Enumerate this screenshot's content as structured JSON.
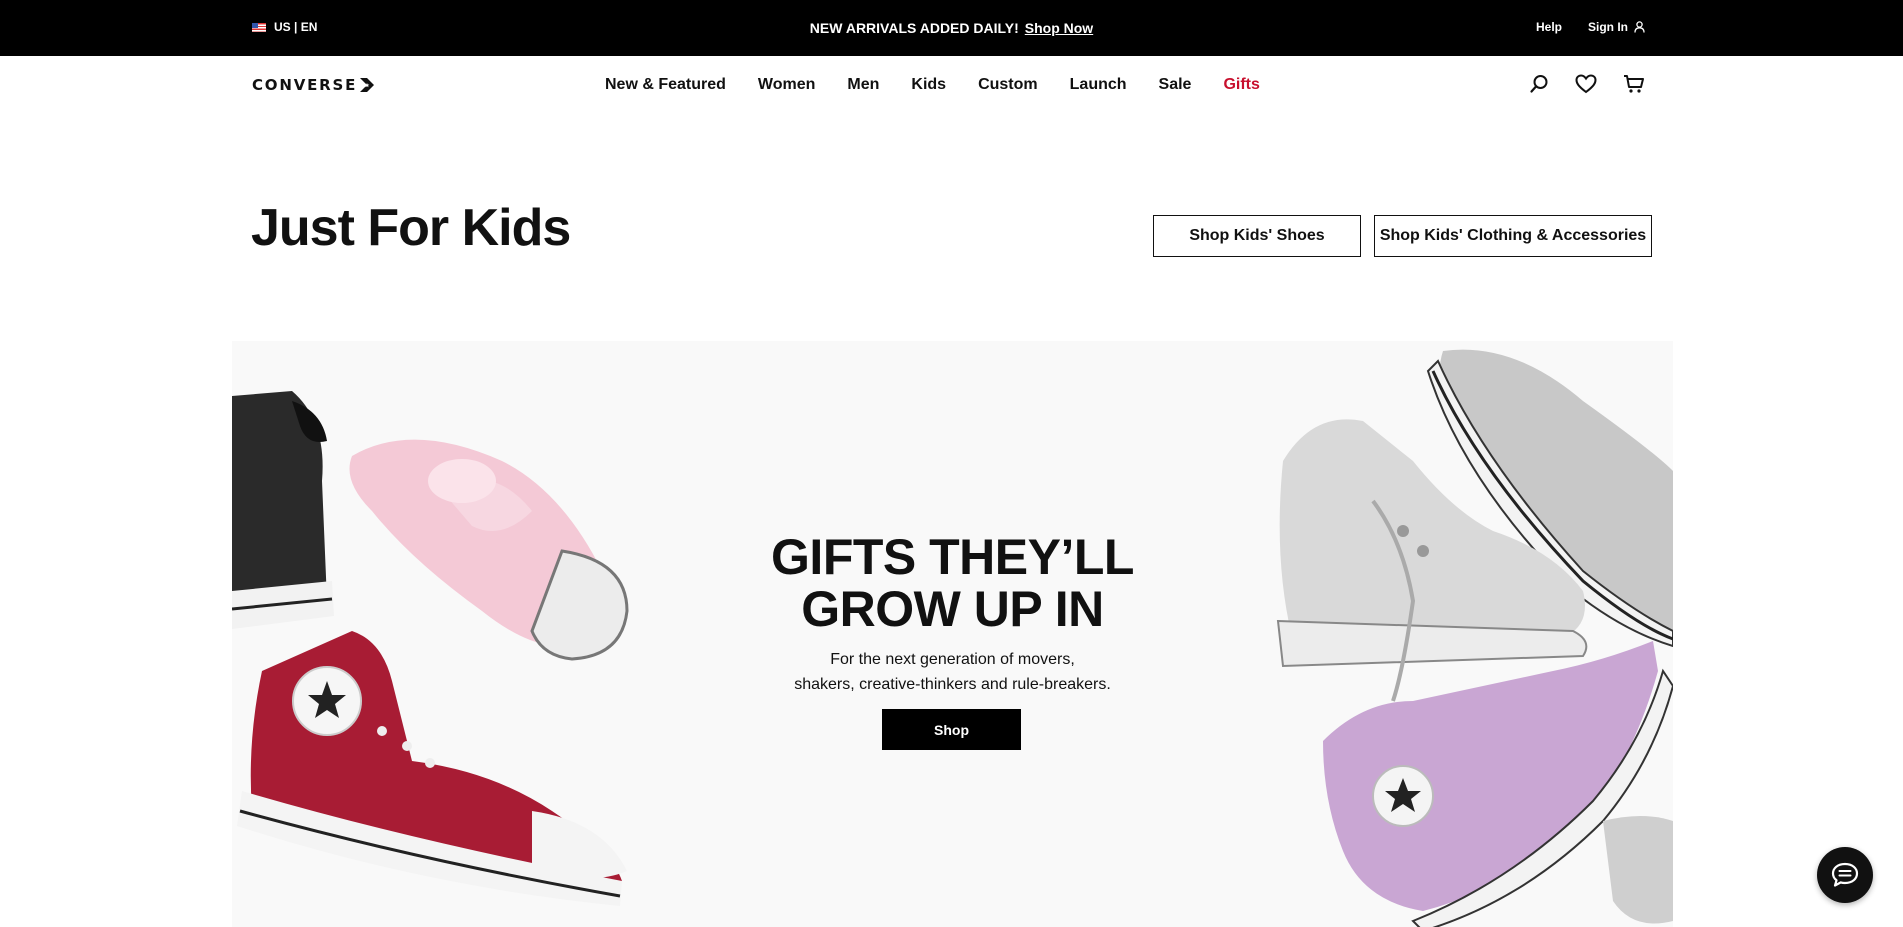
{
  "topbar": {
    "locale": "US | EN",
    "promo_text": "NEW ARRIVALS ADDED DAILY!",
    "promo_link": "Shop Now",
    "help": "Help",
    "sign_in": "Sign In"
  },
  "brand": {
    "logo_text": "CONVERSE"
  },
  "nav": {
    "items": [
      "New & Featured",
      "Women",
      "Men",
      "Kids",
      "Custom",
      "Launch",
      "Sale",
      "Gifts"
    ],
    "highlight_color": "#c8102e"
  },
  "icons": [
    "flag-us-icon",
    "user-icon",
    "search-icon",
    "heart-icon",
    "cart-icon",
    "chat-icon"
  ],
  "page": {
    "title": "Just For Kids",
    "buttons": [
      "Shop Kids' Shoes",
      "Shop Kids' Clothing & Accessories"
    ]
  },
  "hero": {
    "headline_line1": "GIFTS THEY’LL",
    "headline_line2": "GROW UP IN",
    "sub_line1": "For the next generation of movers,",
    "sub_line2": "shakers, creative-thinkers and rule-breakers.",
    "cta": "Shop"
  }
}
